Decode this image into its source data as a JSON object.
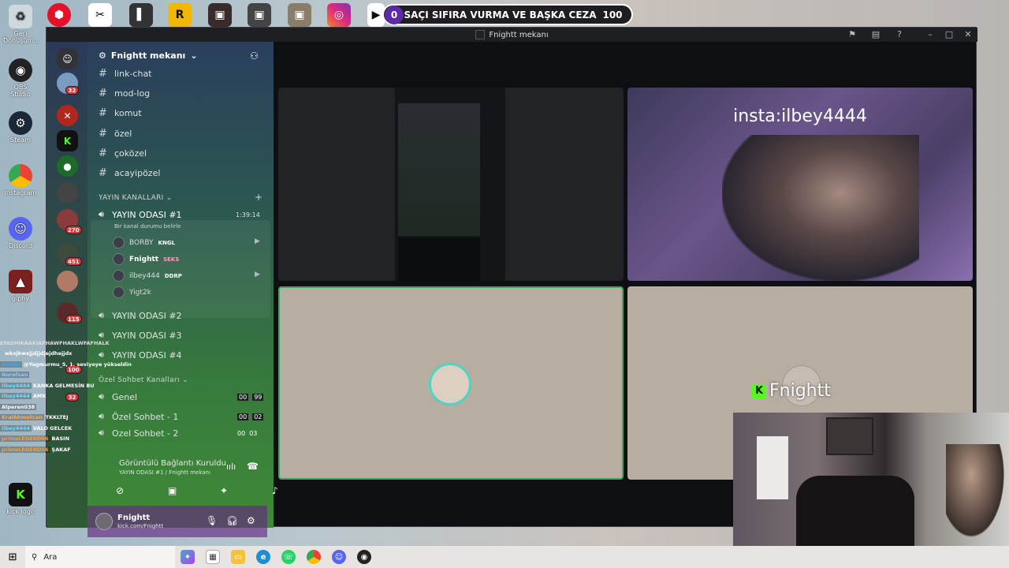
{
  "desktop": {
    "icons": [
      {
        "label": "Geri Dönüşüm...",
        "icon": "recycle-bin-icon"
      },
      {
        "label": "OBS Studio",
        "icon": "obs-icon"
      },
      {
        "label": "Steam",
        "icon": "steam-icon"
      },
      {
        "label": "Instagram",
        "icon": "chrome-icon"
      },
      {
        "label": "Discord",
        "icon": "discord-icon"
      },
      {
        "label": "giphy",
        "icon": "giphy-icon"
      },
      {
        "label": "kick logo",
        "icon": "kick-icon"
      }
    ]
  },
  "overlay": {
    "bet_count": "0",
    "bet_text": "SAÇI SIFIRA VURMA VE BAŞKA CEZA",
    "bet_value": "100",
    "chat": [
      {
        "user": "",
        "msg": "EFASHIKAAKIAFHAWFHAKLWFAFHALK"
      },
      {
        "user": "",
        "msg": "wkxjkwxjjdjjdjejdhejjdx"
      },
      {
        "user": "BotRix",
        "msg": "@Yagmurmu_5, 1. seviyeye yükseldin"
      },
      {
        "user": "Nurefsan",
        "msg": ""
      },
      {
        "user": "ilbey4444",
        "msg": "KANKA GELMESİN BU"
      },
      {
        "user": "ilbey4444",
        "msg": "AMK"
      },
      {
        "user": "Alperen038",
        "msg": ""
      },
      {
        "user": "KralAhmetcan",
        "msg": "TKKLTEJ"
      },
      {
        "user": "ilbey4444",
        "msg": "VALO GELCEK"
      },
      {
        "user": "primeLEGEND56",
        "msg": "BASIN"
      },
      {
        "user": "primeLEGEND56",
        "msg": "ŞAKAF"
      }
    ]
  },
  "window": {
    "title": "Fnightt mekanı"
  },
  "servers": {
    "badges": [
      "32",
      "270",
      "451",
      "115",
      "100",
      "32"
    ]
  },
  "sidebar": {
    "server_name": "Fnightt mekanı",
    "text_channels": [
      "link-chat",
      "mod-log",
      "komut",
      "özel",
      "çoközel",
      "acayipözel"
    ],
    "category_stream": "YAYIN KANALLARI",
    "active_voice": {
      "name": "YAYIN ODASI #1",
      "timer": "1:39:14",
      "status": "Bir kanal durumu belirle"
    },
    "voice_users": [
      {
        "name": "BORBY",
        "tag": "KNGL"
      },
      {
        "name": "Fnightt",
        "tag": "SEKS"
      },
      {
        "name": "ilbey444",
        "tag": "DDRP"
      },
      {
        "name": "Yigt2k",
        "tag": ""
      }
    ],
    "voice_channels": [
      "YAYIN ODASI #2",
      "YAYIN ODASI #3",
      "YAYIN ODASI #4"
    ],
    "category_chat": "Özel Sohbet Kanalları",
    "chat_channels": [
      {
        "name": "Genel",
        "count_a": "00",
        "count_b": "99"
      },
      {
        "name": "Özel Sohbet - 1",
        "count_a": "00",
        "count_b": "02"
      },
      {
        "name": "Özel Sohbet - 2",
        "count_a": "00",
        "count_b": "03"
      }
    ]
  },
  "voice_panel": {
    "status": "Görüntülü Bağlantı Kuruldu",
    "channel": "YAYIN ODASI #1 / Fnightt mekanı"
  },
  "user_panel": {
    "name": "Fnightt",
    "status": "kick.com/Fnightt"
  },
  "stage": {
    "tile2_caption": "insta:ilbey4444",
    "tile4_name": "Fnightt"
  },
  "taskbar": {
    "search_placeholder": "Ara"
  },
  "colors": {
    "accent_green": "#3ba55c",
    "kick_green": "#53fc18",
    "badge_red": "#da373c"
  }
}
